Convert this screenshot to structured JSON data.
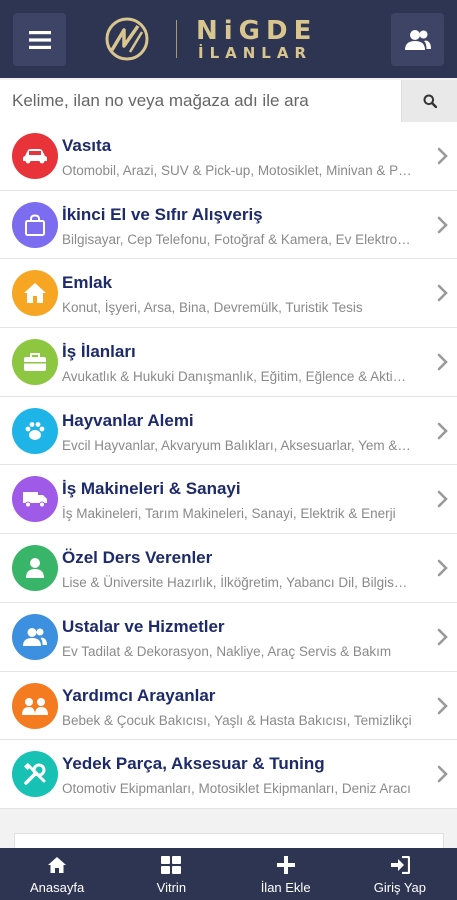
{
  "header": {
    "logo_line1": "NiGDE",
    "logo_line2": "İLANLAR"
  },
  "search": {
    "placeholder": "Kelime, ilan no veya mağaza adı ile ara"
  },
  "categories": [
    {
      "title": "Vasıta",
      "subtitle": "Otomobil, Arazi, SUV & Pick-up, Motosiklet, Minivan & Panelvan",
      "color": "#e8333b",
      "icon": "car-icon"
    },
    {
      "title": "İkinci El ve Sıfır Alışveriş",
      "subtitle": "Bilgisayar, Cep Telefonu, Fotoğraf & Kamera, Ev Elektroniği",
      "color": "#7b6cf0",
      "icon": "shopping-bag-icon"
    },
    {
      "title": "Emlak",
      "subtitle": "Konut, İşyeri, Arsa, Bina, Devremülk, Turistik Tesis",
      "color": "#f6a623",
      "icon": "home-icon"
    },
    {
      "title": "İş İlanları",
      "subtitle": "Avukatlık & Hukuki Danışmanlık, Eğitim, Eğlence & Aktivite",
      "color": "#8dc641",
      "icon": "briefcase-icon"
    },
    {
      "title": "Hayvanlar Alemi",
      "subtitle": "Evcil Hayvanlar, Akvaryum Balıkları, Aksesuarlar, Yem & Mama",
      "color": "#1fb4e8",
      "icon": "paw-icon"
    },
    {
      "title": "İş Makineleri & Sanayi",
      "subtitle": "İş Makineleri, Tarım Makineleri, Sanayi, Elektrik & Enerji",
      "color": "#a05ae8",
      "icon": "truck-icon"
    },
    {
      "title": "Özel Ders Verenler",
      "subtitle": "Lise & Üniversite Hazırlık, İlköğretim, Yabancı Dil, Bilgisayar",
      "color": "#39b56a",
      "icon": "person-icon"
    },
    {
      "title": "Ustalar ve Hizmetler",
      "subtitle": "Ev Tadilat & Dekorasyon, Nakliye, Araç Servis & Bakım",
      "color": "#3d8fe0",
      "icon": "users-icon"
    },
    {
      "title": "Yardımcı Arayanlar",
      "subtitle": "Bebek & Çocuk Bakıcısı, Yaşlı & Hasta Bakıcısı, Temizlikçi",
      "color": "#f47b20",
      "icon": "group-icon"
    },
    {
      "title": "Yedek Parça, Aksesuar & Tuning",
      "subtitle": "Otomotiv Ekipmanları, Motosiklet Ekipmanları, Deniz Aracı",
      "color": "#17c1b4",
      "icon": "tools-icon"
    }
  ],
  "bottom_nav": [
    {
      "label": "Anasayfa",
      "icon": "home-icon"
    },
    {
      "label": "Vitrin",
      "icon": "grid-icon"
    },
    {
      "label": "İlan Ekle",
      "icon": "plus-icon"
    },
    {
      "label": "Giriş Yap",
      "icon": "login-icon"
    }
  ]
}
